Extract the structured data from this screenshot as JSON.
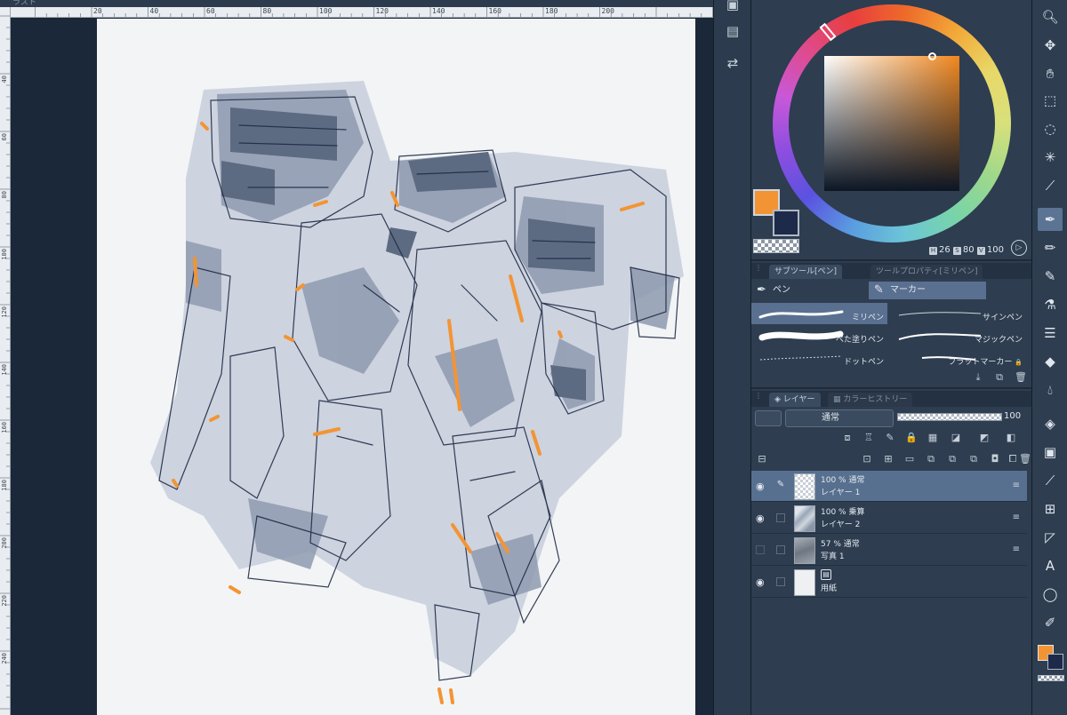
{
  "window": {
    "title_fragment": "ラスト"
  },
  "ruler": {
    "top_labels": [
      "20",
      "40",
      "60",
      "80",
      "100",
      "120",
      "140",
      "160",
      "180",
      "200"
    ],
    "left_labels": [
      "40",
      "60",
      "80",
      "100",
      "120",
      "140",
      "160",
      "180",
      "200",
      "220",
      "240"
    ]
  },
  "mini_strip": {
    "icons": [
      "fill-icon",
      "save-icon",
      "transform-icon"
    ]
  },
  "color": {
    "main": "#f39434",
    "sub": "#1e2a4a",
    "hsv": {
      "h_tag": "H",
      "h": "26",
      "s_tag": "S",
      "s": "80",
      "v_tag": "V",
      "v": "100"
    },
    "mode_glyph": "▷"
  },
  "subtool_panel": {
    "tabs": [
      "サブツール[ペン]",
      "ツールプロパティ[ミリペン]"
    ],
    "groups": [
      "ペン",
      "マーカー"
    ],
    "brushes": [
      {
        "name": "ミリペン",
        "selected": true
      },
      {
        "name": "サインペン",
        "selected": false
      },
      {
        "name": "べた塗りペン",
        "selected": false
      },
      {
        "name": "マジックペン",
        "selected": false
      },
      {
        "name": "ドットペン",
        "selected": false
      },
      {
        "name": "フラットマーカー",
        "selected": false
      }
    ],
    "lock_glyph": "🔒"
  },
  "layer_panel": {
    "tabs": [
      "レイヤー",
      "カラーヒストリー"
    ],
    "blend_mode": "通常",
    "opacity": "100",
    "layers": [
      {
        "opacity_mode": "100 % 通常",
        "name": "レイヤー 1",
        "visible": true,
        "selected": true
      },
      {
        "opacity_mode": "100 % 乗算",
        "name": "レイヤー 2",
        "visible": true,
        "selected": false
      },
      {
        "opacity_mode": "57 % 通常",
        "name": "写真 1",
        "visible": false,
        "selected": false
      },
      {
        "opacity_mode": "",
        "name": "用紙",
        "visible": true,
        "selected": false
      }
    ]
  },
  "tools": [
    "zoom",
    "move",
    "hand",
    "operation",
    "lasso-select",
    "auto-select",
    "eyedropper",
    "pen",
    "pencil",
    "brush",
    "airbrush",
    "decoration",
    "eraser",
    "blend",
    "fill",
    "gradient",
    "line",
    "frame",
    "ruler",
    "text",
    "balloon",
    "correction-line"
  ],
  "glyphs": {
    "eye": "◉",
    "menu": "≡",
    "pen_edit": "✎"
  }
}
